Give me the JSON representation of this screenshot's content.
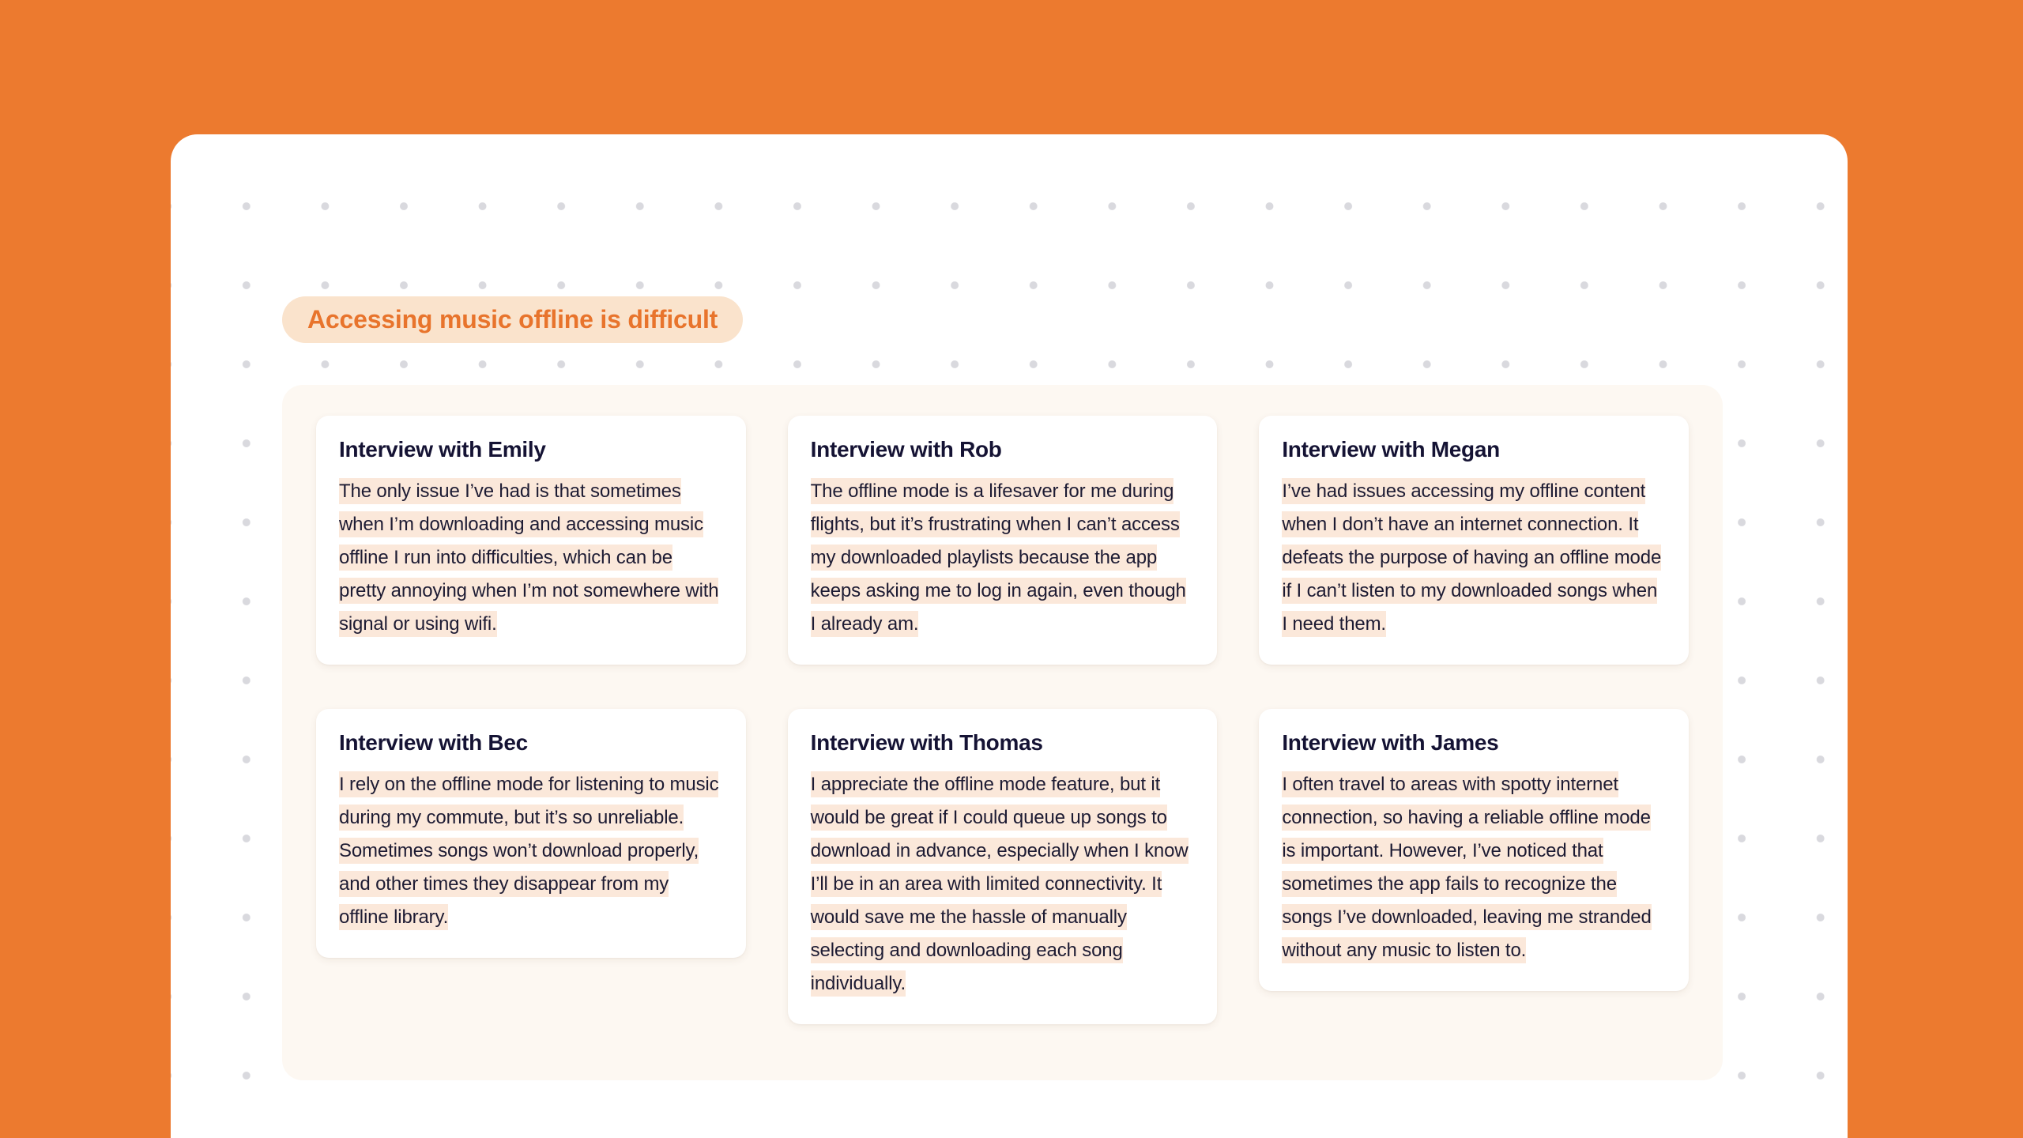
{
  "theme": {
    "page_background": "#ec7a2f",
    "window_background": "#ffffff",
    "panel_background": "#fdf8f2",
    "card_background": "#ffffff",
    "pill_background": "#fae3cc",
    "pill_text_color": "#e8742c",
    "highlight_color": "#fbe8da",
    "text_color": "#151334",
    "dot_color": "#d9d9de"
  },
  "header": {
    "title": "Accessing music offline is difficult"
  },
  "cards": [
    {
      "title": "Interview with Emily",
      "quote": "The only issue I’ve had is that sometimes when I’m downloading and accessing music offline I run into difficulties, which can be pretty annoying when I’m not somewhere with signal or using wifi."
    },
    {
      "title": "Interview with Rob",
      "quote": "The offline mode is a lifesaver for me during flights, but it’s frustrating when I can’t access my downloaded playlists because the app keeps asking me to log in again, even though I already am."
    },
    {
      "title": "Interview with Megan",
      "quote": "I’ve had issues accessing my offline content when I don’t have an internet connection. It defeats the purpose of having an offline mode if I can’t listen to my downloaded songs when I need them."
    },
    {
      "title": "Interview with Bec",
      "quote": "I rely on the offline mode for listening to music during my commute, but it’s so unreliable. Sometimes songs won’t download properly, and other times they disappear from my offline library."
    },
    {
      "title": "Interview with Thomas",
      "quote": "I appreciate the offline mode feature, but it would be great if I could queue up songs to download in advance, especially when I know I’ll be in an area with limited connectivity. It would save me the hassle of manually selecting and downloading each song individually."
    },
    {
      "title": "Interview with James",
      "quote": "I often travel to areas with spotty internet connection, so having a reliable offline mode is important. However, I’ve noticed that sometimes the app fails to recognize the songs I’ve downloaded, leaving me stranded without any music to listen to."
    }
  ]
}
